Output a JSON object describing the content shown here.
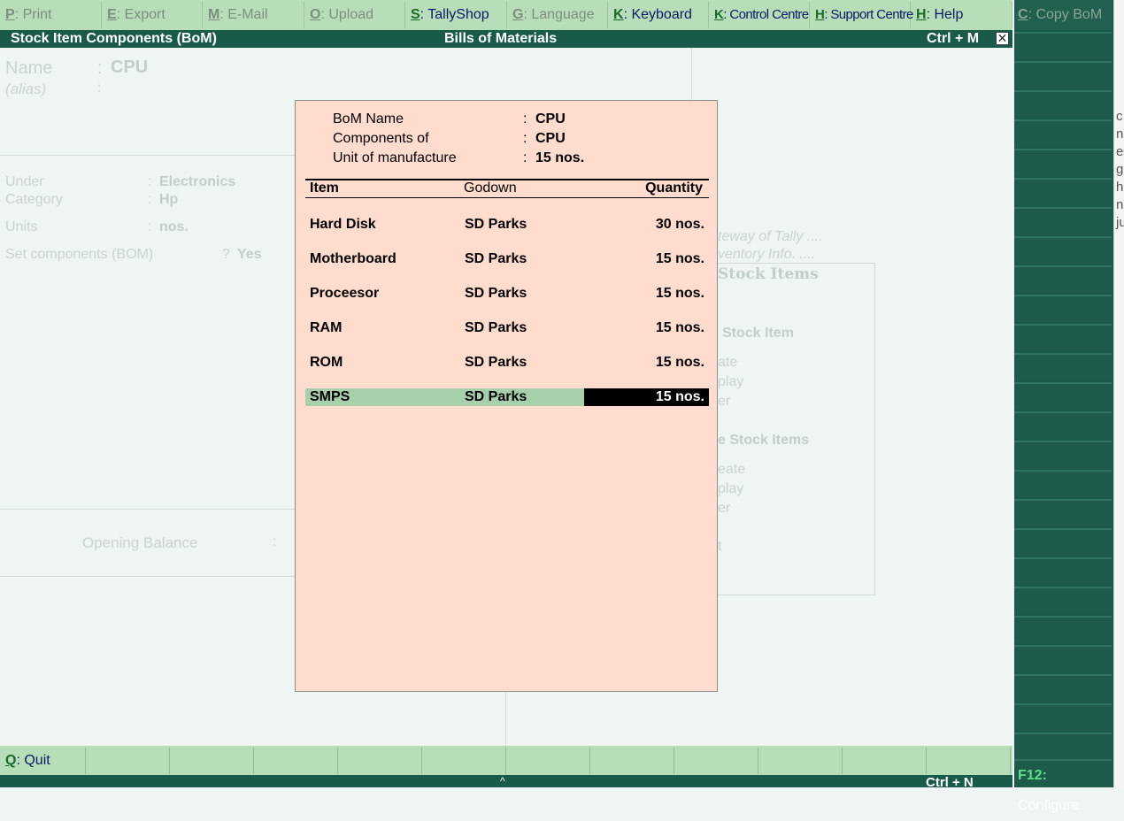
{
  "top_menu": [
    {
      "key": "P",
      "label": "Print",
      "enabled": false
    },
    {
      "key": "E",
      "label": "Export",
      "enabled": false
    },
    {
      "key": "M",
      "label": "E-Mail",
      "enabled": false
    },
    {
      "key": "O",
      "label": "Upload",
      "enabled": false
    },
    {
      "key": "S",
      "label": "TallyShop",
      "enabled": true
    },
    {
      "key": "G",
      "label": "Language",
      "enabled": false
    },
    {
      "key": "K",
      "label": "Keyboard",
      "enabled": true
    },
    {
      "key": "K",
      "label": "Control Centre",
      "enabled": true
    },
    {
      "key": "H",
      "label": "Support Centre",
      "enabled": true
    },
    {
      "key": "H",
      "label": "Help",
      "enabled": true
    }
  ],
  "title_bar": {
    "left": "Stock Item Components (BoM)",
    "center": "Bills of Materials",
    "shortcut": "Ctrl + M",
    "close_glyph": "✕"
  },
  "background_form": {
    "name_label": "Name",
    "name_value": "CPU",
    "alias_label": "(alias)",
    "under_label": "Under",
    "under_value": "Electronics",
    "category_label": "Category",
    "category_value": "Hp",
    "units_label": "Units",
    "units_value": "nos.",
    "bom_label": "Set components (BOM)",
    "bom_q": "?",
    "bom_value": "Yes",
    "opening_label": "Opening Balance",
    "side_text_1": "teway of Tally ....",
    "side_text_2": "ventory Info. ....",
    "side_heading": "Stock Items",
    "side_sub1": "Stock Item",
    "side_s1_a": "ate",
    "side_s1_b": "play",
    "side_s1_c": "er",
    "side_sub2": "e Stock Items",
    "side_s2_a": "eate",
    "side_s2_b": "play",
    "side_s2_c": "er",
    "side_s3": "t",
    "edge_chars": "c\nn\nex\nge\nhi\nna\nju"
  },
  "popup": {
    "bom_name_label": "BoM Name",
    "bom_name": "CPU",
    "components_label": "Components of",
    "components_of": "CPU",
    "unit_label": "Unit of manufacture",
    "unit_value": "15 nos.",
    "colon": ":",
    "col_item": "Item",
    "col_godown": "Godown",
    "col_qty": "Quantity",
    "rows": [
      {
        "item": "Hard Disk",
        "godown": "SD Parks",
        "qty": "30 nos."
      },
      {
        "item": "Motherboard",
        "godown": "SD Parks",
        "qty": "15 nos."
      },
      {
        "item": "Proceesor",
        "godown": "SD Parks",
        "qty": "15 nos."
      },
      {
        "item": "RAM",
        "godown": "SD Parks",
        "qty": "15 nos."
      },
      {
        "item": "ROM",
        "godown": "SD Parks",
        "qty": "15 nos."
      },
      {
        "item": "SMPS",
        "godown": "SD Parks",
        "qty": "15 nos.",
        "selected": true
      }
    ]
  },
  "right_panel": {
    "copy_bom_key": "C",
    "copy_bom_label": "Copy BoM",
    "configure_key": "F12:",
    "configure_label": "Configure"
  },
  "bottom_bar": {
    "quit_key": "Q",
    "quit_label": "Quit",
    "status_shortcut": "Ctrl + N",
    "caret": "^"
  }
}
